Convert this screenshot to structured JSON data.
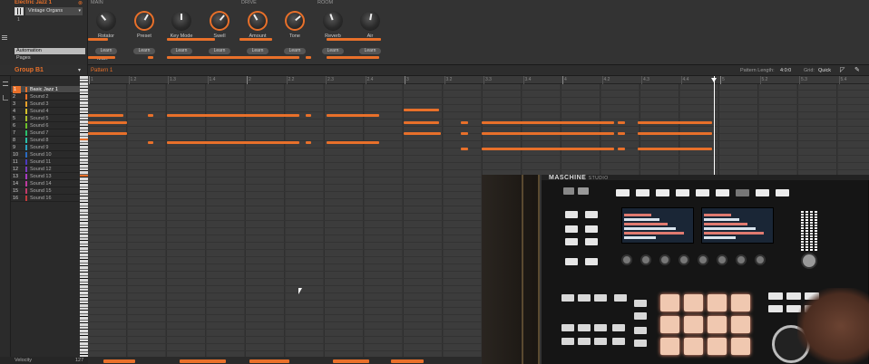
{
  "plugin": {
    "name": "Electric Jazz 1",
    "close_glyph": "⊗",
    "preset": "Vintage Organs",
    "preset_arrow": "▾",
    "instance": "1",
    "tabs": [
      "Automation",
      "Pages"
    ],
    "midi_label": "MIDI",
    "sections": [
      "MAIN",
      "DRIVE",
      "ROOM"
    ],
    "knobs": [
      "Rotator",
      "Preset",
      "Key Mode",
      "Swell",
      "Amount",
      "Tone",
      "Reverb",
      "Air"
    ],
    "learn_label": "Learn"
  },
  "group": {
    "name": "Group B1",
    "arrow": "▾"
  },
  "pattern": {
    "name": "Pattern 1",
    "length_label": "Pattern Length:",
    "length_value": "4:0:0",
    "grid_label": "Grid:",
    "grid_value": "Quick"
  },
  "ruler_ticks": [
    "1",
    "1.2",
    "1.3",
    "1.4",
    "2",
    "2.2",
    "2.3",
    "2.4",
    "3",
    "3.2",
    "3.3",
    "3.4",
    "4",
    "4.2",
    "4.3",
    "4.4",
    "5",
    "5.2",
    "5.3",
    "5.4"
  ],
  "sounds": [
    {
      "num": "1",
      "name": "Basic Jazz 1",
      "color": "#e8702a"
    },
    {
      "num": "2",
      "name": "Sound 2",
      "color": "#e8702a"
    },
    {
      "num": "3",
      "name": "Sound 3",
      "color": "#e8a02a"
    },
    {
      "num": "4",
      "name": "Sound 4",
      "color": "#d6c02a"
    },
    {
      "num": "5",
      "name": "Sound 5",
      "color": "#a8c02a"
    },
    {
      "num": "6",
      "name": "Sound 6",
      "color": "#6ac02a"
    },
    {
      "num": "7",
      "name": "Sound 7",
      "color": "#2ac06a"
    },
    {
      "num": "8",
      "name": "Sound 8",
      "color": "#2ac0a8"
    },
    {
      "num": "9",
      "name": "Sound 9",
      "color": "#2aa0c0"
    },
    {
      "num": "10",
      "name": "Sound 10",
      "color": "#2a6ac0"
    },
    {
      "num": "11",
      "name": "Sound 11",
      "color": "#4a3ac0"
    },
    {
      "num": "12",
      "name": "Sound 12",
      "color": "#7a3ac0"
    },
    {
      "num": "13",
      "name": "Sound 13",
      "color": "#a83ac0"
    },
    {
      "num": "14",
      "name": "Sound 14",
      "color": "#c03aa0"
    },
    {
      "num": "15",
      "name": "Sound 15",
      "color": "#c03a6a"
    },
    {
      "num": "16",
      "name": "Sound 16",
      "color": "#c03a3a"
    }
  ],
  "velocity": {
    "label": "Velocity",
    "max": "127"
  },
  "device": {
    "brand": "MASCHINE",
    "model": "STUDIO"
  },
  "colors": {
    "accent": "#e8702a",
    "background": "#2b2b2b",
    "grid": "#3c3c3c"
  }
}
